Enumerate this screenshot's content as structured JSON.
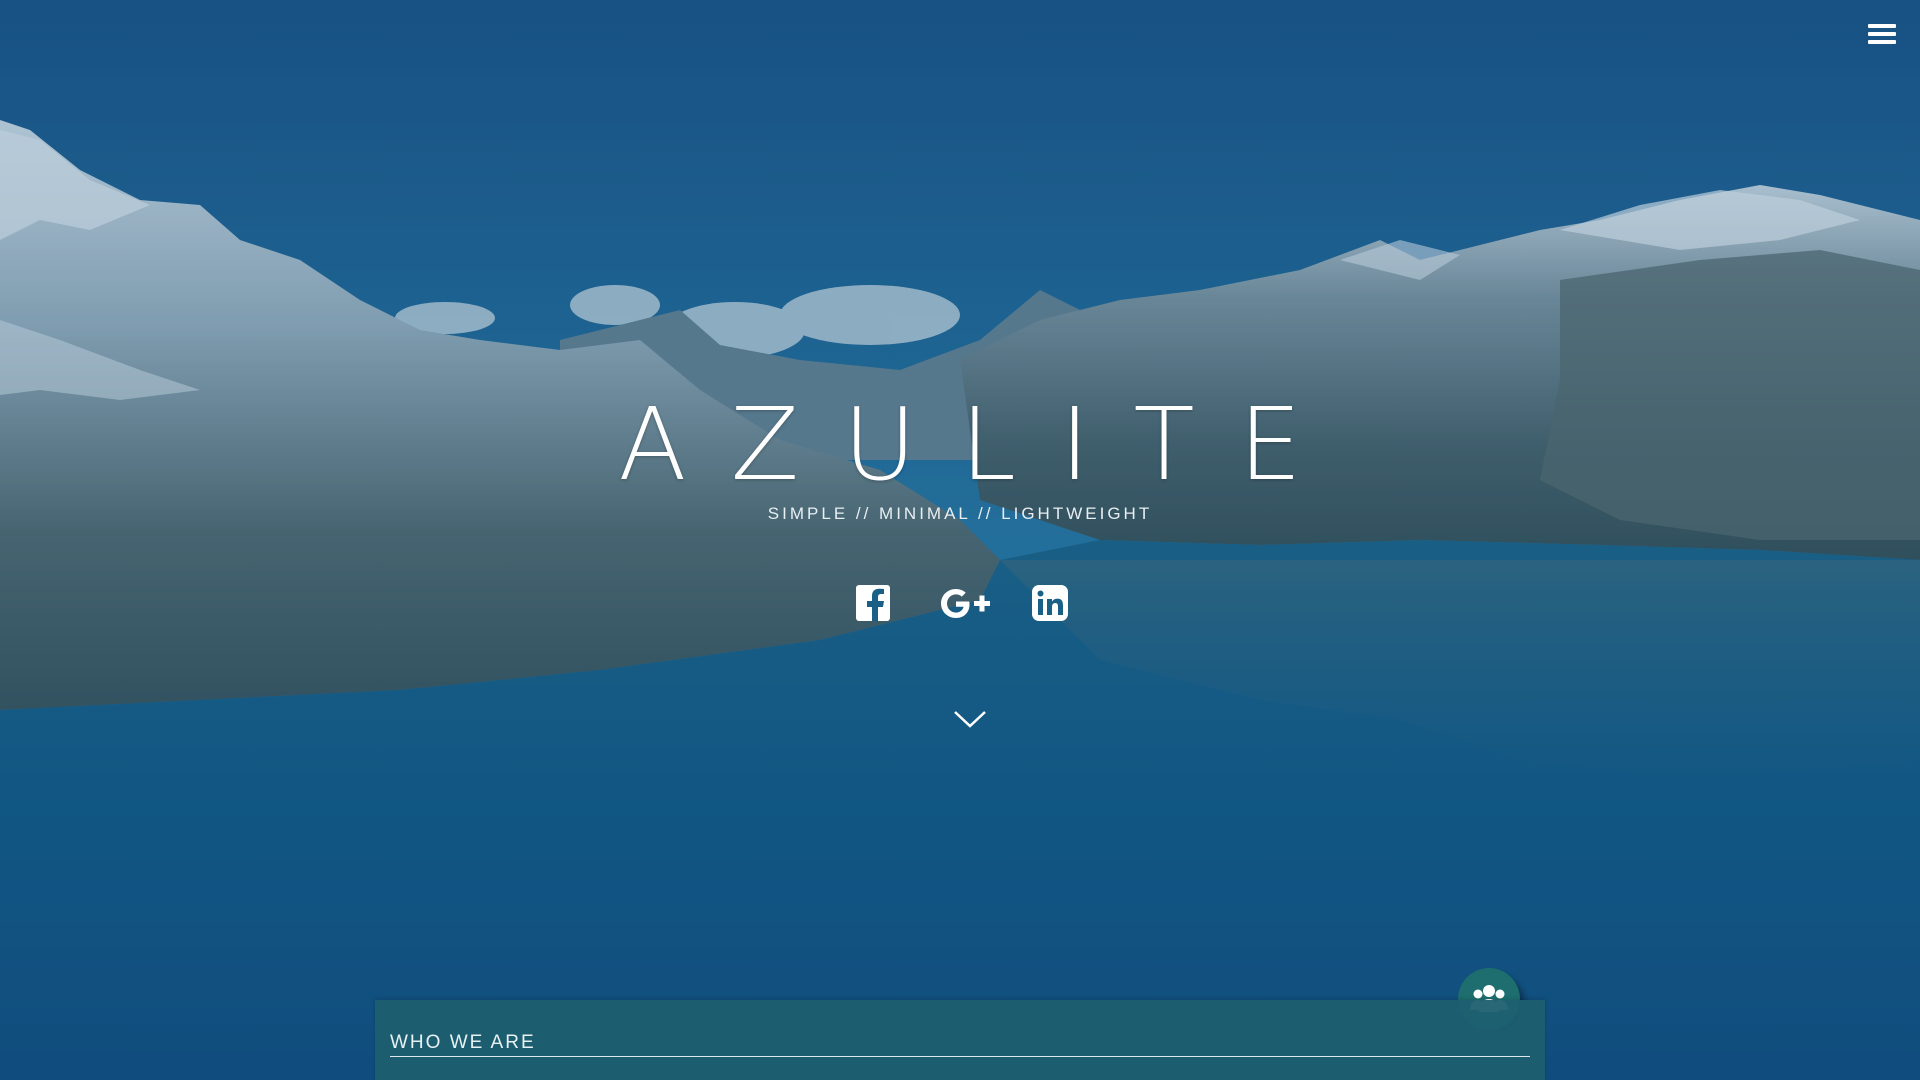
{
  "hero": {
    "title": "AZULITE",
    "tagline": "SIMPLE  //  MINIMAL  //  LIGHTWEIGHT"
  },
  "nav": {
    "menu_icon": "hamburger-menu-icon"
  },
  "social": [
    {
      "name": "Facebook",
      "icon": "facebook-icon"
    },
    {
      "name": "Google Plus",
      "icon": "google-plus-icon"
    },
    {
      "name": "LinkedIn",
      "icon": "linkedin-icon"
    }
  ],
  "scroll_icon": "chevron-down-icon",
  "section": {
    "heading": "WHO WE ARE",
    "badge_icon": "team-users-icon"
  },
  "colors": {
    "sky": "#1f5f90",
    "water": "#125a85",
    "panel": "#1e5f70",
    "badge": "#1e6e6f",
    "text": "#ffffff"
  }
}
